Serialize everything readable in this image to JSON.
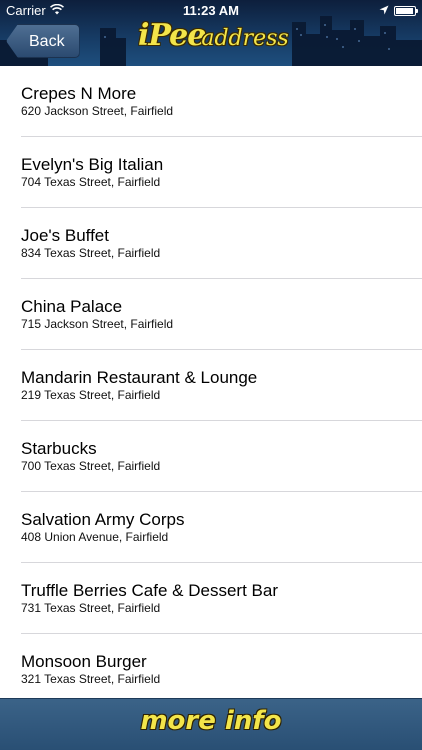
{
  "status_bar": {
    "carrier": "Carrier",
    "time": "11:23 AM"
  },
  "header": {
    "back_label": "Back",
    "logo_main": "iPee",
    "logo_sub": "address"
  },
  "places": [
    {
      "name": "Crepes N More",
      "address": "620 Jackson Street, Fairfield"
    },
    {
      "name": "Evelyn's Big Italian",
      "address": "704 Texas Street, Fairfield"
    },
    {
      "name": "Joe's Buffet",
      "address": "834 Texas Street, Fairfield"
    },
    {
      "name": "China Palace",
      "address": "715 Jackson Street, Fairfield"
    },
    {
      "name": "Mandarin Restaurant & Lounge",
      "address": "219 Texas Street, Fairfield"
    },
    {
      "name": "Starbucks",
      "address": "700 Texas Street, Fairfield"
    },
    {
      "name": "Salvation Army Corps",
      "address": "408 Union Avenue, Fairfield"
    },
    {
      "name": "Truffle Berries Cafe & Dessert Bar",
      "address": "731 Texas Street, Fairfield"
    },
    {
      "name": "Monsoon Burger",
      "address": "321 Texas Street, Fairfield"
    }
  ],
  "footer": {
    "more_info_label": "more info"
  },
  "colors": {
    "accent_yellow": "#f3e54a",
    "header_blue": "#163a63",
    "footer_blue": "#294f74"
  },
  "icons": [
    "wifi-icon",
    "location-arrow-icon",
    "battery-icon"
  ]
}
